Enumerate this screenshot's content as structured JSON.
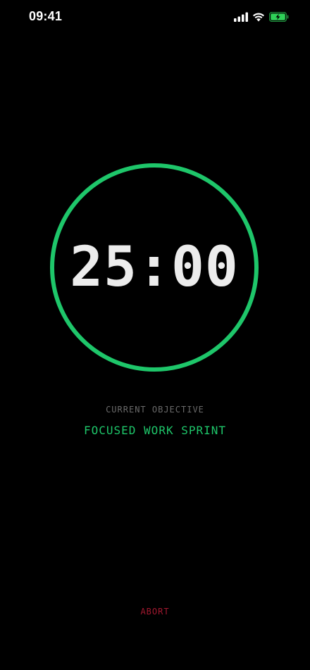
{
  "status_bar": {
    "time": "09:41",
    "icons": [
      "signal-icon",
      "wifi-icon",
      "battery-charging-icon"
    ],
    "battery_color": "#2fd158"
  },
  "timer": {
    "display": "25:00",
    "ring_color": "#1ec66a",
    "progress": 1.0
  },
  "objective": {
    "label": "CURRENT OBJECTIVE",
    "value": "FOCUSED WORK SPRINT"
  },
  "actions": {
    "abort_label": "ABORT",
    "abort_color": "#a3182f"
  }
}
